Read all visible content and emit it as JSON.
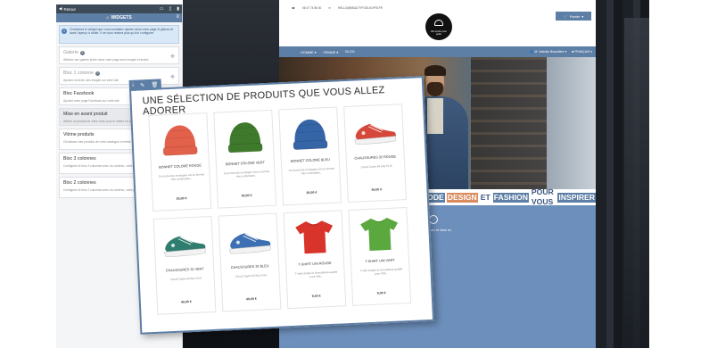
{
  "panel": {
    "back_label": "Retour",
    "title": "WIDGETS",
    "info_text": "Choisissez le widget que vous souhaitez ajouter dans votre page et glissez-le dans l'aperçu à droite. Il ne vous restera plus qu'à le configurer.",
    "widgets": [
      {
        "title": "Galerie",
        "desc": "Affichez une galerie photo dans votre page avec images et textes",
        "disabled": true,
        "help": true
      },
      {
        "title": "Bloc 1 colonne",
        "desc": "Ajoutez du texte, des images sur votre site",
        "disabled": true,
        "help": true
      },
      {
        "title": "Bloc Facebook",
        "desc": "Ajoutez votre page Facebook sur votre site",
        "disabled": false,
        "help": false
      },
      {
        "title": "Mise en avant produit",
        "desc": "Affiche un produit de votre choix pour le mettre en avant",
        "disabled": false,
        "help": false
      },
      {
        "title": "Vitrine produits",
        "desc": "Choisissez des produits de votre catalogue à mettre en avant",
        "disabled": false,
        "help": false
      },
      {
        "title": "Bloc 3 colonnes",
        "desc": "Configurez le bloc 3 colonnes avec du contenu, votre page facebook, image...",
        "disabled": false,
        "help": false
      },
      {
        "title": "Bloc 2 colonnes",
        "desc": "Configurez le bloc 2 colonnes avec du contenu, votre page facebook, image...",
        "disabled": false,
        "help": false
      }
    ]
  },
  "site": {
    "phone": "06 47 74 86 00",
    "email": "HELLO@BEAUTYFOOLKOPIS.FR",
    "logo_text": "chic & fière pour petits",
    "cart_label": "Panier",
    "nav_items": [
      "HOMME",
      "FEMME",
      "BLOG"
    ],
    "account_label": "M. Valentin Beaudière",
    "language_label": "FRANÇAIS",
    "slogan": [
      "MODE",
      "DESIGN",
      "ET",
      "FASHION",
      "POUR VOUS",
      "INSPIRER"
    ],
    "drop_hint": "déposez le bloc ici"
  },
  "card": {
    "title": "UNE SÉLECTION DE PRODUITS QUE VOUS ALLEZ ADORER",
    "products": [
      {
        "name": "BONNET COLORÉ ROUGE",
        "desc": "Ce bonnet de montagne est un bonnet très confortable...",
        "price": "30,00 €",
        "kind": "beanie",
        "color": "#e2614b"
      },
      {
        "name": "BONNET COLORÉ VERT",
        "desc": "Ce bonnet de montagne est un bonnet très confortable...",
        "price": "30,00 €",
        "kind": "beanie",
        "color": "#3f7a2c"
      },
      {
        "name": "BONNET COLORÉ BLEU",
        "desc": "Ce bonnet de montagne est un bonnet très confortable...",
        "price": "30,00 €",
        "kind": "beanie",
        "color": "#3565a6"
      },
      {
        "name": "CHAUSSURES 32 ROUGE",
        "desc": "Chuck Taylor All Star Hi Hi",
        "price": "40,00 €",
        "kind": "shoe",
        "color": "#d5473b"
      },
      {
        "name": "CHAUSSURES 32 VERT",
        "desc": "Chuck Taylor All Star Hi Hi",
        "price": "40,00 €",
        "kind": "shoe",
        "color": "#2f7d6e"
      },
      {
        "name": "CHAUSSURES 32 BLEU",
        "desc": "Chuck Taylor All Star Hi Hi",
        "price": "40,00 €",
        "kind": "shoe",
        "color": "#3d6fb3"
      },
      {
        "name": "T-SHIRT UNI ROUGE",
        "desc": "T-shirt simple et d'excellente qualité pour l'été...",
        "price": "9,00 €",
        "kind": "tshirt",
        "color": "#d8342c"
      },
      {
        "name": "T-SHIRT UNI VERT",
        "desc": "T-shirt simple et d'excellente qualité pour l'été...",
        "price": "9,00 €",
        "kind": "tshirt",
        "color": "#5aa83e"
      }
    ]
  },
  "colors": {
    "accent": "#5d7ea5",
    "orange": "#d98c5f"
  }
}
